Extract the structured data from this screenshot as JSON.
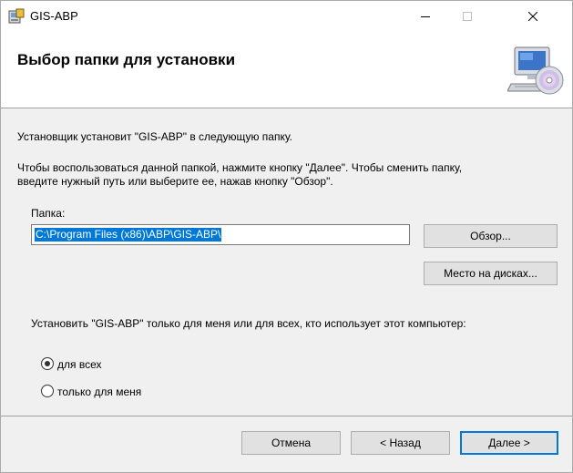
{
  "window": {
    "title": "GIS-ABP"
  },
  "banner": {
    "title": "Выбор папки для установки"
  },
  "body": {
    "line1": "Установщик установит \"GIS-ABP\" в следующую папку.",
    "line2": "Чтобы воспользоваться данной папкой, нажмите кнопку \"Далее\". Чтобы сменить папку,",
    "line3": "введите нужный путь или выберите ее, нажав кнопку \"Обзор\".",
    "folder_label": "Папка:",
    "folder_path": "C:\\Program Files (x86)\\ABP\\GIS-ABP\\",
    "browse_label": "Обзор...",
    "disk_cost_label": "Место на дисках...",
    "scope_question": "Установить \"GIS-ABP\" только для меня или для всех, кто использует этот компьютер:",
    "options": [
      {
        "label": "для всех",
        "checked": true
      },
      {
        "label": "только для меня",
        "checked": false
      }
    ]
  },
  "footer": {
    "cancel_label": "Отмена",
    "back_label": "< Назад",
    "next_label": "Далее >"
  },
  "colors": {
    "accent": "#0078d7",
    "panel": "#f0f0f0",
    "button_face": "#e1e1e1"
  }
}
